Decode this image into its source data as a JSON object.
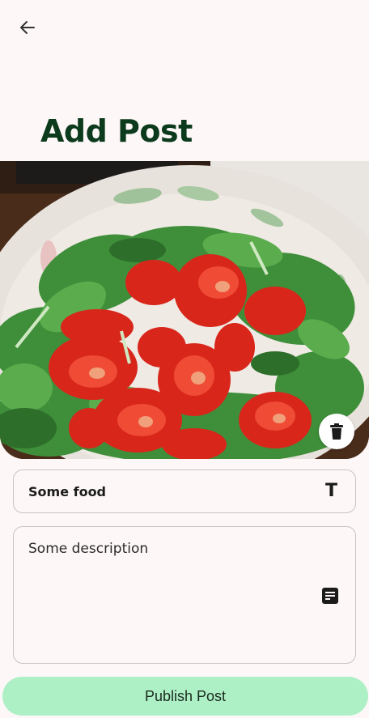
{
  "header": {
    "back_icon": "arrow-left-icon",
    "title": "Add Post"
  },
  "photo": {
    "subject": "salad-photo",
    "delete_icon": "trash-icon"
  },
  "form": {
    "title_field": {
      "value": "Some food",
      "icon": "T"
    },
    "description_field": {
      "value": "Some description",
      "icon": "notes-icon"
    }
  },
  "actions": {
    "publish_label": "Publish Post"
  },
  "colors": {
    "background": "#fdf7f7",
    "title": "#0c3a1c",
    "publish_button": "#aef0c6",
    "field_border": "#c9c3c3"
  }
}
